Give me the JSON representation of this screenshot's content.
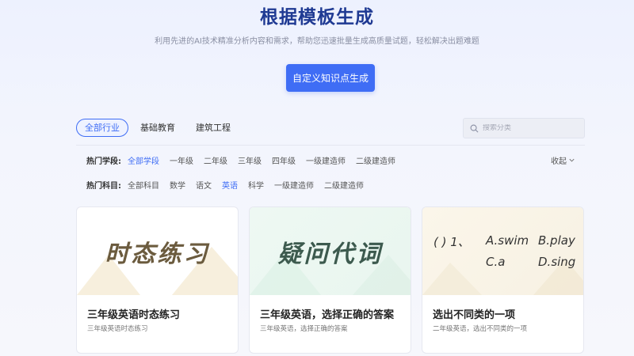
{
  "hero": {
    "title": "根据模板生成",
    "subtitle": "利用先进的AI技术精准分析内容和需求，帮助您迅速批量生成高质量试题，轻松解决出题难题",
    "button_label": "自定义知识点生成"
  },
  "industry_tabs": [
    "全部行业",
    "基础教育",
    "建筑工程"
  ],
  "search": {
    "placeholder": "搜索分类"
  },
  "filters": {
    "school": {
      "label": "热门学段:",
      "options": [
        "全部学段",
        "一年级",
        "二年级",
        "三年级",
        "四年级",
        "一级建造师",
        "二级建造师"
      ],
      "active": "全部学段"
    },
    "subject": {
      "label": "热门科目:",
      "options": [
        "全部科目",
        "数学",
        "语文",
        "英语",
        "科学",
        "一级建造师",
        "二级建造师"
      ],
      "active": "英语"
    },
    "collapse_label": "收起"
  },
  "cards": [
    {
      "banner_text": "时态练习",
      "title": "三年级英语时态练习",
      "desc": "三年级英语时态练习"
    },
    {
      "banner_text": "疑问代词",
      "title": "三年级英语，选择正确的答案",
      "desc": "三年级英语，选择正确的答案"
    },
    {
      "banner_quiz": {
        "stem": "(    ) 1、",
        "options": [
          "A.swim",
          "B.play",
          "C.a",
          "D.sing"
        ]
      },
      "title": "选出不同类的一项",
      "desc": "二年级英语，选出不同类的一项"
    }
  ],
  "colors": {
    "accent": "#3f6df5",
    "hero_title": "#1f3a93"
  }
}
